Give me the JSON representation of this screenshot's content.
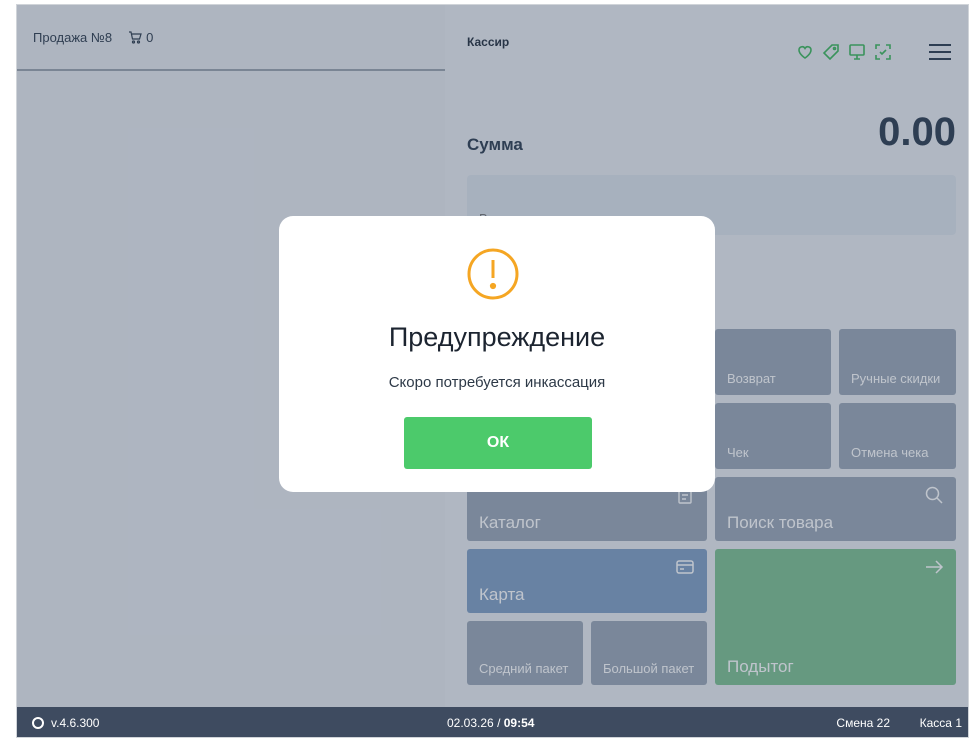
{
  "left": {
    "sale_title": "Продажа №8",
    "cart_count": "0"
  },
  "header": {
    "cashier": "Кассир",
    "status_icons": [
      "heart-icon",
      "tag-icon",
      "monitor-icon",
      "scan-icon"
    ],
    "menu_icon": "menu-icon"
  },
  "sum": {
    "label": "Сумма",
    "value": "0.00"
  },
  "code_input": {
    "placeholder": "Введите код товара"
  },
  "tiles": {
    "return": "Возврат",
    "manual_discounts": "Ручные скидки",
    "receipt": "Чек",
    "cancel_receipt": "Отмена чека",
    "catalog": "Каталог",
    "search": "Поиск товара",
    "card": "Карта",
    "medium_bag": "Средний пакет",
    "large_bag": "Большой пакет",
    "subtotal": "Подытог"
  },
  "status_bar": {
    "version": "v.4.6.300",
    "date": "02.03.26",
    "separator": "/",
    "time": "09:54",
    "shift": "Смена 22",
    "register": "Касса 1"
  },
  "dialog": {
    "title": "Предупреждение",
    "message": "Скоро потребуется инкассация",
    "ok_label": "ОК",
    "icon": "warning-icon"
  },
  "colors": {
    "accent_green": "#4cca6b",
    "warning_orange": "#f5a623",
    "status_bar": "#3e4b60",
    "card_tile": "#4a72a8",
    "subtotal_tile": "#3f9a57"
  }
}
